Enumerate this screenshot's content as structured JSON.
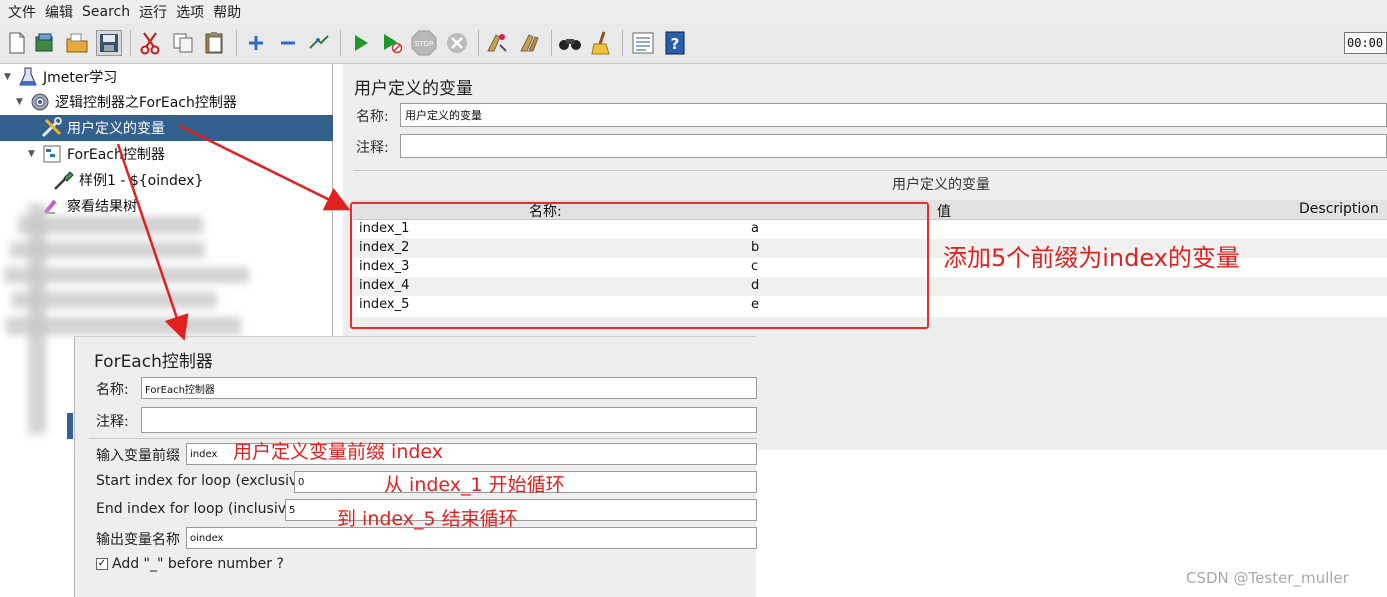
{
  "menu": [
    "文件",
    "编辑",
    "Search",
    "运行",
    "选项",
    "帮助"
  ],
  "toolbar": {
    "icons": [
      "new-icon",
      "templates-icon",
      "open-icon",
      "save-icon",
      "cut-icon",
      "copy-icon",
      "paste-icon",
      "expand-icon",
      "collapse-icon",
      "toggle-icon",
      "start-icon",
      "start-no-pause-icon",
      "stop-icon",
      "shutdown-icon",
      "clear-icon",
      "clear-all-icon",
      "search-icon",
      "reset-search-icon",
      "function-helper-icon",
      "help-icon"
    ],
    "timer": "00:00:"
  },
  "tree": {
    "root": "Jmeter学习",
    "thread_group": "逻辑控制器之ForEach控制器",
    "udv": "用户定义的变量",
    "foreach": "ForEach控制器",
    "sampler": "样例1 - ${oindex}",
    "listener": "察看结果树"
  },
  "udv_panel": {
    "title": "用户定义的变量",
    "name_label": "名称:",
    "name_value": "用户定义的变量",
    "comment_label": "注释:",
    "comment_value": "",
    "section_title": "用户定义的变量",
    "columns": [
      "名称:",
      "值",
      "Description"
    ],
    "rows": [
      {
        "name": "index_1",
        "value": "a",
        "desc": ""
      },
      {
        "name": "index_2",
        "value": "b",
        "desc": ""
      },
      {
        "name": "index_3",
        "value": "c",
        "desc": ""
      },
      {
        "name": "index_4",
        "value": "d",
        "desc": ""
      },
      {
        "name": "index_5",
        "value": "e",
        "desc": ""
      }
    ]
  },
  "foreach_panel": {
    "title": "ForEach控制器",
    "name_label": "名称:",
    "name_value": "ForEach控制器",
    "comment_label": "注释:",
    "comment_value": "",
    "prefix_label": "输入变量前缀",
    "prefix_value": "index",
    "start_label": "Start index for loop (exclusive)",
    "start_value": "0",
    "end_label": "End index for loop (inclusive)",
    "end_value": "5",
    "output_label": "输出变量名称",
    "output_value": "oindex",
    "add_underscore_label": "Add \"_\" before number ?",
    "add_underscore_checked": true
  },
  "annotations": {
    "vars_note": "添加5个前缀为index的变量",
    "prefix_note": "用户定义变量前缀 index",
    "start_note": "从 index_1 开始循环",
    "end_note": "到 index_5 结束循环"
  },
  "watermark": "CSDN @Tester_muller",
  "colors": {
    "selection": "#34608d",
    "annotation": "#e32020",
    "panel_bg": "#eeeeee"
  }
}
